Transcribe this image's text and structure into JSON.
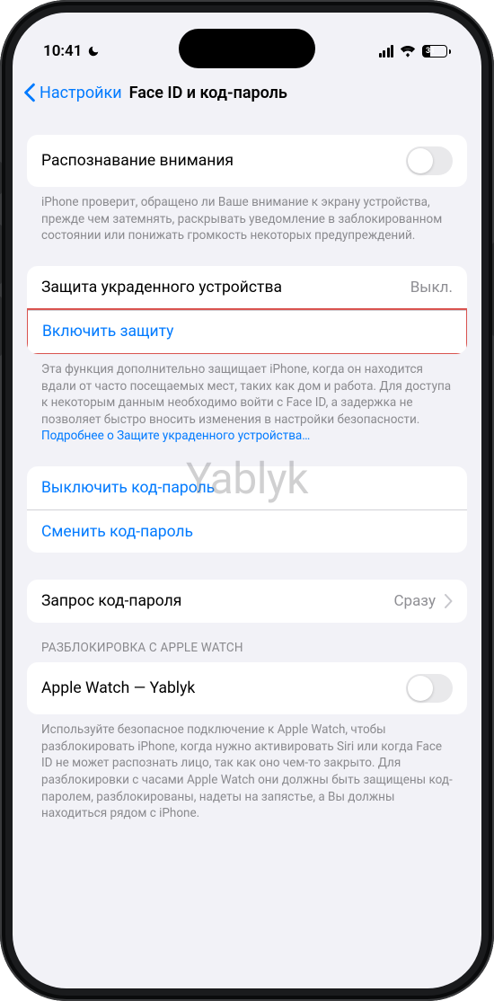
{
  "status": {
    "time": "10:41",
    "battery": "31"
  },
  "nav": {
    "back": "Настройки",
    "title": "Face ID и код-пароль"
  },
  "attention": {
    "label": "Распознавание внимания",
    "footer": "iPhone проверит, обращено ли Ваше внимание к экрану устройства, прежде чем затемнять, раскрывать уведомление в заблокированном состоянии или понижать громкость некоторых предупреждений."
  },
  "stolen": {
    "label": "Защита украденного устройства",
    "value": "Выкл.",
    "action": "Включить защиту",
    "footer": "Эта функция дополнительно защищает iPhone, когда он находится вдали от часто посещаемых мест, таких как дом и работа. Для доступа к некоторым данным необходимо войти с Face ID, а задержка не позволяет быстро вносить изменения в настройки безопасности. ",
    "learn_more": "Подробнее о Защите украденного устройства…"
  },
  "passcode": {
    "disable": "Выключить код-пароль",
    "change": "Сменить код-пароль"
  },
  "require": {
    "label": "Запрос код-пароля",
    "value": "Сразу"
  },
  "watch": {
    "header": "РАЗБЛОКИРОВКА С APPLE WATCH",
    "device": "Apple Watch — Yablyk",
    "footer": "Используйте безопасное подключение к Apple Watch, чтобы разблокировать iPhone, когда нужно активировать Siri или когда Face ID не может распознать лицо, так как оно чем-то закрыто. Для разблокировки с часами Apple Watch они должны быть защищены код-паролем, разблокированы, надеты на запястье, а Вы должны находиться рядом с iPhone."
  },
  "watermark": "Yablyk"
}
